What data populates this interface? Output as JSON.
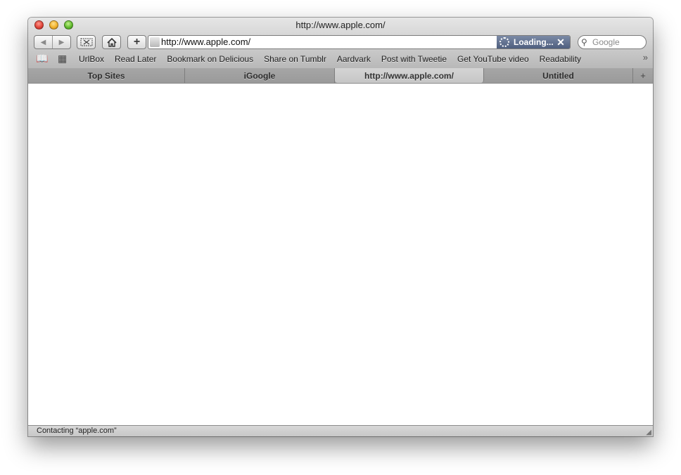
{
  "window": {
    "title": "http://www.apple.com/"
  },
  "toolbar": {
    "back_icon": "back-arrow-icon",
    "forward_icon": "forward-arrow-icon",
    "snip_icon": "scissors-icon",
    "home_icon": "home-icon",
    "add_icon": "plus-icon"
  },
  "address": {
    "url": "http://www.apple.com/",
    "status": "Loading...",
    "stop_label": "✕"
  },
  "search": {
    "placeholder": "Google"
  },
  "bookmarks": {
    "items": [
      {
        "label": "UrlBox"
      },
      {
        "label": "Read Later"
      },
      {
        "label": "Bookmark on Delicious"
      },
      {
        "label": "Share on Tumblr"
      },
      {
        "label": "Aardvark"
      },
      {
        "label": "Post with Tweetie"
      },
      {
        "label": "Get YouTube video"
      },
      {
        "label": "Readability"
      }
    ],
    "more_label": "»"
  },
  "tabs": [
    {
      "label": "Top Sites",
      "active": false
    },
    {
      "label": "iGoogle",
      "active": false
    },
    {
      "label": "http://www.apple.com/",
      "active": true
    },
    {
      "label": "Untitled",
      "active": false
    }
  ],
  "tab_add_label": "+",
  "statusbar": {
    "text": "Contacting “apple.com”"
  },
  "colors": {
    "loading_bg": "#5a6a88",
    "chrome_top": "#e6e6e6",
    "chrome_bottom": "#b8b8b8"
  }
}
